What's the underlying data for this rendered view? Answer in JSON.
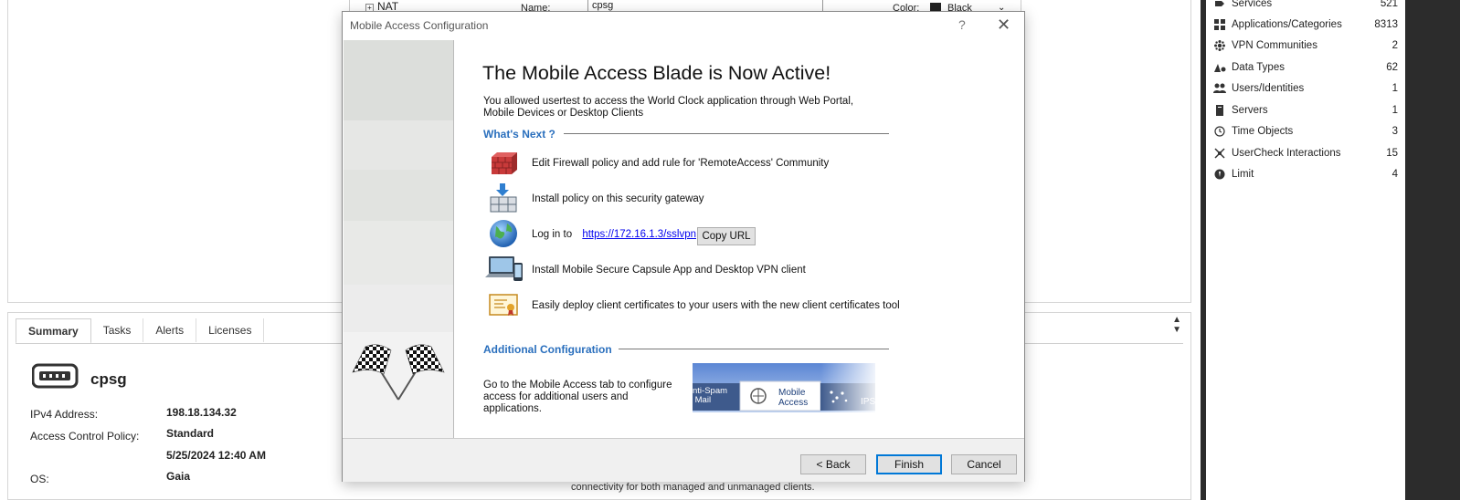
{
  "background": {
    "tree_nat": "NAT",
    "name_label": "Name:",
    "name_value": "cpsg",
    "color_label": "Color:",
    "color_value": "Black",
    "tabs": [
      "Summary",
      "Tasks",
      "Alerts",
      "Licenses"
    ],
    "gateway_name": "cpsg",
    "props": [
      {
        "label": "IPv4 Address:",
        "value": "198.18.134.32"
      },
      {
        "label": "Access Control Policy:",
        "value": "Standard"
      },
      {
        "label": "",
        "value": "5/25/2024 12:40 AM"
      },
      {
        "label": "OS:",
        "value": "Gaia"
      }
    ],
    "bottom_text": "connectivity for both managed and unmanaged clients."
  },
  "sidebar": {
    "items": [
      {
        "label": "Services",
        "count": "521",
        "icon": "services-icon"
      },
      {
        "label": "Applications/Categories",
        "count": "8313",
        "icon": "applications-icon"
      },
      {
        "label": "VPN Communities",
        "count": "2",
        "icon": "vpn-icon"
      },
      {
        "label": "Data Types",
        "count": "62",
        "icon": "data-types-icon"
      },
      {
        "label": "Users/Identities",
        "count": "1",
        "icon": "users-icon"
      },
      {
        "label": "Servers",
        "count": "1",
        "icon": "servers-icon"
      },
      {
        "label": "Time Objects",
        "count": "3",
        "icon": "clock-icon"
      },
      {
        "label": "UserCheck Interactions",
        "count": "15",
        "icon": "usercheck-icon"
      },
      {
        "label": "Limit",
        "count": "4",
        "icon": "limit-icon"
      }
    ]
  },
  "dialog": {
    "title": "Mobile Access Configuration",
    "help": "?",
    "headline": "The Mobile Access Blade is Now Active!",
    "intro": "You allowed usertest to access the World Clock application through Web Portal, Mobile Devices or Desktop Clients",
    "whats_next": "What's Next ?",
    "steps": [
      {
        "text": "Edit Firewall policy and add rule for 'RemoteAccess' Community",
        "icon": "firewall-icon"
      },
      {
        "text": "Install policy on this security gateway",
        "icon": "install-policy-icon"
      },
      {
        "text": "Log in to",
        "icon": "globe-icon"
      },
      {
        "text": "Install Mobile Secure Capsule App and Desktop VPN client",
        "icon": "devices-icon"
      },
      {
        "text": "Easily deploy client certificates to your users with the new client certificates tool",
        "icon": "certificate-icon"
      }
    ],
    "login_url": "https://172.16.1.3/sslvpn",
    "copy_url": "Copy URL",
    "additional_config": "Additional Configuration",
    "bottom_text": "Go to the Mobile Access tab to configure access for additional users and applications.",
    "strip_tabs": {
      "left": "nti-Spam\n Mail",
      "mid": "Mobile\nAccess",
      "right": "IPS"
    },
    "buttons": {
      "back": "< Back",
      "finish": "Finish",
      "cancel": "Cancel"
    },
    "colors": {
      "accent": "#2a6fbd",
      "default_button": "#0078d7"
    }
  }
}
